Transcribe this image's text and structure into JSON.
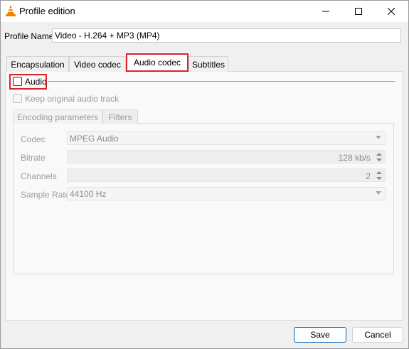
{
  "window": {
    "title": "Profile edition",
    "icon": "vlc-cone-icon",
    "controls": [
      "minimize-icon",
      "maximize-icon",
      "close-icon"
    ]
  },
  "profile": {
    "label": "Profile Name",
    "value": "Video - H.264 + MP3 (MP4)"
  },
  "tabs": [
    {
      "label": "Encapsulation",
      "selected": false
    },
    {
      "label": "Video codec",
      "selected": false
    },
    {
      "label": "Audio codec",
      "selected": true
    },
    {
      "label": "Subtitles",
      "selected": false
    }
  ],
  "audio": {
    "checkbox_label": "Audio",
    "checked": false,
    "keep_original_label": "Keep original audio track",
    "keep_original_checked": false
  },
  "subtabs": [
    {
      "label": "Encoding parameters",
      "selected": true
    },
    {
      "label": "Filters",
      "selected": false
    }
  ],
  "fields": {
    "codec": {
      "label": "Codec",
      "value": "MPEG Audio"
    },
    "bitrate": {
      "label": "Bitrate",
      "value": "128 kb/s"
    },
    "channels": {
      "label": "Channels",
      "value": "2"
    },
    "sample_rate": {
      "label": "Sample Rate",
      "value": "44100 Hz"
    }
  },
  "buttons": {
    "save": "Save",
    "cancel": "Cancel"
  },
  "colors": {
    "highlight": "#d9232f",
    "default_button_border": "#005fb8",
    "disabled_text": "#9b9b9b",
    "vlc_orange": "#f08200"
  }
}
